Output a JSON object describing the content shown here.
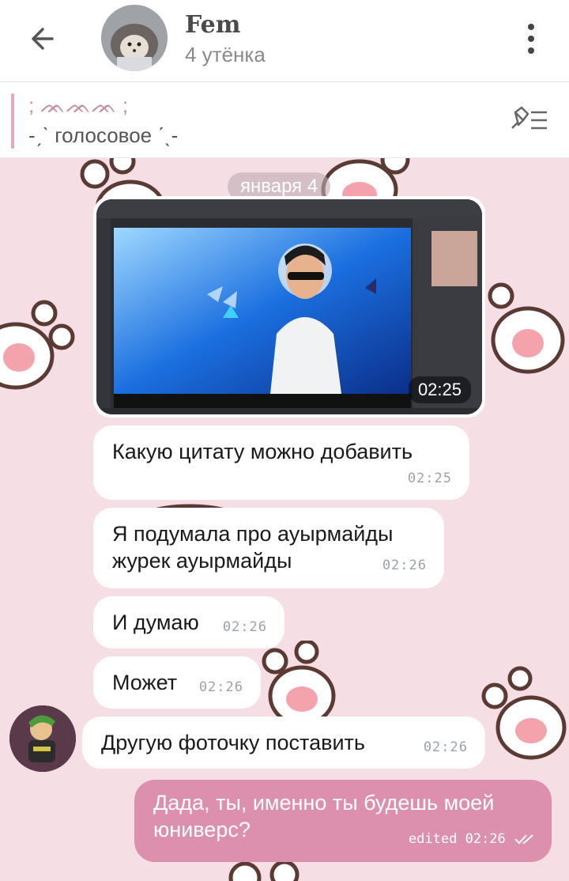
{
  "header": {
    "title": "Fem",
    "subtitle": "4 утёнка",
    "back_icon": "arrow-left-icon",
    "menu_icon": "more-vertical-icon"
  },
  "pinned": {
    "line1": "; ᨏᨏᨏ ;",
    "line2": "-ˏˋ голосовое ˊˎ-",
    "icon": "pin-list-icon"
  },
  "chat": {
    "date": "января 4",
    "media_time": "02:25",
    "messages": [
      {
        "text": "Какую цитату можно добавить",
        "time": "02:25"
      },
      {
        "text": "Я подумала про ауырмайды журек ауырмайды",
        "time": "02:26"
      },
      {
        "text": "И думаю",
        "time": "02:26"
      },
      {
        "text": "Может",
        "time": "02:26"
      },
      {
        "text": "Другую фоточку поставить",
        "time": "02:26"
      }
    ],
    "outgoing": {
      "text": "Дада, ты, именно ты будешь моей юниверс?",
      "time": "edited 02:26"
    }
  },
  "colors": {
    "background": "#f6dfe4",
    "outgoing_bubble": "#dd8fae",
    "accent": "#e2a8be"
  }
}
